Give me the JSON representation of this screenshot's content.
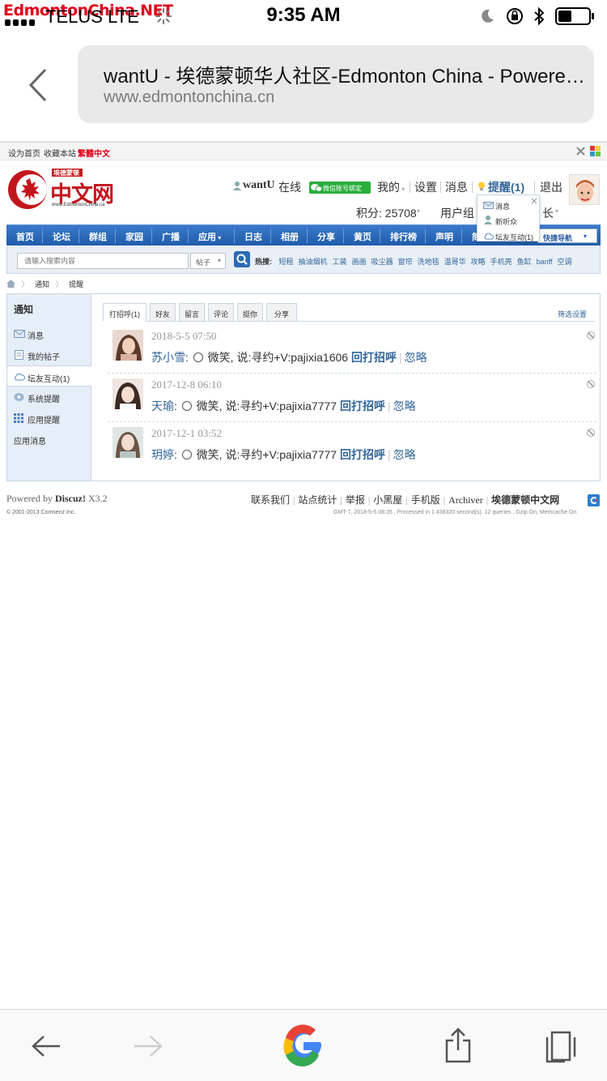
{
  "status": {
    "watermark": "EdmontonChina.NET",
    "carrier": "TELUS LTE",
    "time": "9:35 AM"
  },
  "browser": {
    "title": "wantU - 埃德蒙顿华人社区-Edmonton China - Powered by Discuz!",
    "url": "www.edmontonchina.cn"
  },
  "topbar": {
    "set_home": "设为首页",
    "bookmark": "收藏本站",
    "traditional": "繁體中文"
  },
  "logo": {
    "small_text": "埃德蒙顿",
    "main_text": "中文网",
    "domain": "www.EdmontonChina.ca"
  },
  "userbar": {
    "username": "wantU",
    "online": "在线",
    "wechat_bind": "微信账号绑定",
    "mine": "我的",
    "settings": "设置",
    "messages": "消息",
    "reminders": "提醒(1)",
    "logout": "退出",
    "points": "积分: 25708",
    "user_group": "用户组",
    "group_suffix": "长"
  },
  "nav": {
    "items": [
      "首页",
      "论坛",
      "群组",
      "家园",
      "广播",
      "应用",
      "日志",
      "相册",
      "分享",
      "黄页",
      "排行榜",
      "声明",
      "简"
    ],
    "quick": "快捷导航"
  },
  "search": {
    "placeholder": "请输入搜索内容",
    "type": "帖子",
    "hot_label": "热搜:",
    "hot": [
      "短租",
      "抽油烟机",
      "工装",
      "画画",
      "吸尘器",
      "窗帘",
      "洗地毯",
      "温哥华",
      "攻略",
      "手机壳",
      "鱼缸",
      "banff",
      "空调"
    ]
  },
  "crumbs": {
    "c1": "通知",
    "c2": "提醒"
  },
  "sidebar": {
    "head": "通知",
    "items": [
      "消息",
      "我的帖子",
      "坛友互动(1)",
      "系统提醒",
      "应用提醒",
      "应用消息"
    ]
  },
  "tabs": {
    "items": [
      "打招呼(1)",
      "好友",
      "留言",
      "评论",
      "挺你",
      "分享"
    ],
    "filter": "筛选设置"
  },
  "notices": [
    {
      "time": "2018-5-5 07:50",
      "who": "苏小雪",
      "text": "微笑, 说:寻约+V:pajixia1606",
      "reply": "回打招呼",
      "ignore": "忽略"
    },
    {
      "time": "2017-12-8 06:10",
      "who": "天瑜",
      "text": "微笑, 说:寻约+V:pajixia7777",
      "reply": "回打招呼",
      "ignore": "忽略"
    },
    {
      "time": "2017-12-1 03:52",
      "who": "玥婷",
      "text": "微笑, 说:寻约+V:pajixia7777",
      "reply": "回打招呼",
      "ignore": "忽略"
    }
  ],
  "popup": {
    "items": [
      "消息",
      "新听众",
      "坛友互动(1)"
    ]
  },
  "footer": {
    "powered": "Powered by",
    "discuz": "Discuz!",
    "version": "X3.2",
    "copyright": "© 2001-2013 Comsenz Inc.",
    "links": [
      "联系我们",
      "站点统计",
      "举报",
      "小黑屋",
      "手机版",
      "Archiver",
      "埃德蒙顿中文网"
    ],
    "process": "GMT-7, 2018-5-5 08:35 , Processed in 1.438320 second(s), 12 queries , Gzip On, Memcache On."
  }
}
